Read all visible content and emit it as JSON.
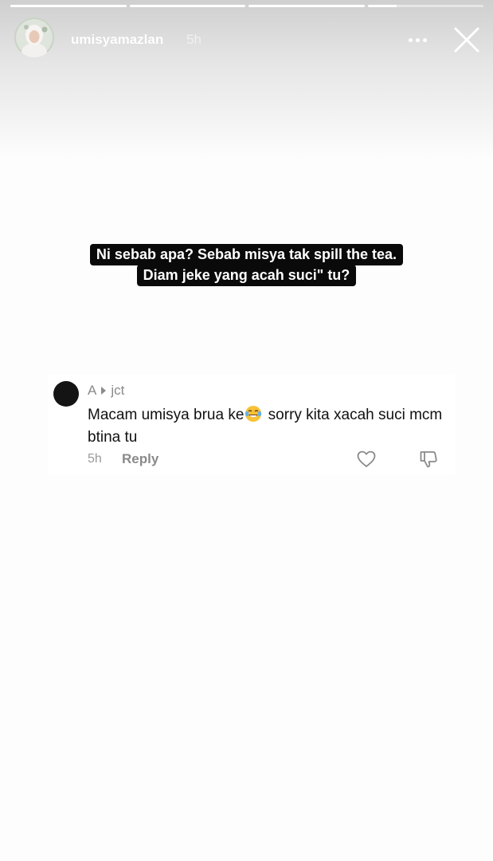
{
  "story": {
    "segments": [
      {
        "progress": 1.0
      },
      {
        "progress": 1.0
      },
      {
        "progress": 1.0
      },
      {
        "progress": 0.25
      }
    ],
    "username": "umisyamazlan",
    "time": "5h",
    "more_icon": "more-horizontal-icon",
    "close_icon": "close-icon"
  },
  "caption": {
    "line1": "Ni sebab apa? Sebab misya tak spill the tea.",
    "line2": "Diam jeke yang acah suci\" tu?"
  },
  "comment": {
    "author": "A",
    "reply_to": "jct",
    "text_before_emoji": "Macam umisya brua ke",
    "emoji": "face-with-tears-of-joy-icon",
    "text_after_emoji": " sorry kita xacah suci mcm btina tu",
    "time": "5h",
    "reply_label": "Reply",
    "like_icon": "heart-icon",
    "dislike_icon": "thumbs-down-icon"
  },
  "colors": {
    "caption_bg": "#0a0a0a",
    "caption_text": "#ffffff",
    "meta_gray": "#8a8a8a"
  }
}
